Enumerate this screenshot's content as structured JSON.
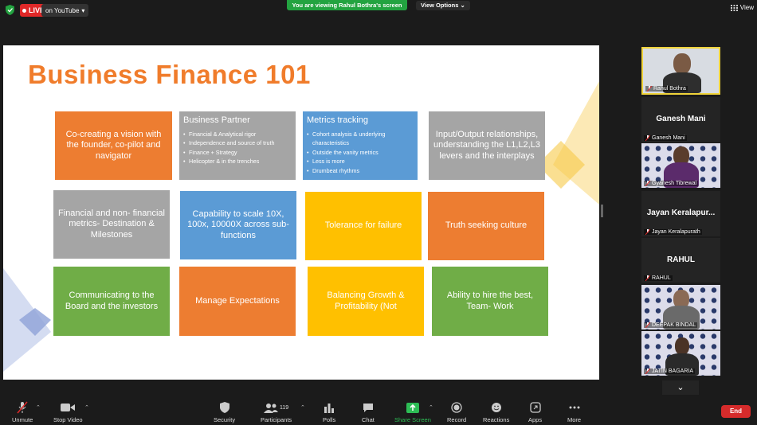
{
  "top_bar": {
    "live_label": "LIVE",
    "youtube_label": "on YouTube",
    "viewing_banner": "You are viewing Rahul Bothra's screen",
    "view_options_label": "View Options",
    "view_label": "View"
  },
  "slide": {
    "title": "Business Finance 101",
    "row1": [
      {
        "text": "Co-creating a vision with the founder, co-pilot and navigator"
      },
      {
        "heading": "Business Partner",
        "bullets": [
          "Financial & Analytical rigor",
          "Independence and source of truth",
          "Finance + Strategy",
          "Helicopter & in the trenches"
        ]
      },
      {
        "heading": "Metrics tracking",
        "bullets": [
          "Cohort analysis & underlying characteristics",
          "Outside the vanity metrics",
          "Less is more",
          "Drumbeat rhythms"
        ]
      },
      {
        "text": "Input/Output relationships, understanding the L1,L2,L3 levers and the interplays"
      }
    ],
    "row2": [
      {
        "text": "Financial and non- financial metrics- Destination & Milestones"
      },
      {
        "text": "Capability to scale 10X, 100x, 10000X across sub-functions"
      },
      {
        "text": "Tolerance for failure"
      },
      {
        "text": "Truth seeking culture"
      }
    ],
    "row3": [
      {
        "text": "Communicating to the Board and the investors"
      },
      {
        "text": "Manage Expectations"
      },
      {
        "text": "Balancing Growth & Profitability (Not"
      },
      {
        "text": "Ability to hire the best, Team- Work"
      }
    ]
  },
  "participants": {
    "speaker": "Rahul Bothra",
    "ganesh_big": "Ganesh Mani",
    "ganesh_small": "Ganesh Mani",
    "gyanesh": "Gyanesh Tibrewal",
    "jayan_big": "Jayan Keralapur...",
    "jayan_small": "Jayan Keralapurath",
    "rahul_big": "RAHUL",
    "rahul_small": "RAHUL",
    "deepak": "DEEPAK BINDAL",
    "jatin": "JATIN BAGARIA"
  },
  "toolbar": {
    "unmute": "Unmute",
    "stop_video": "Stop Video",
    "security": "Security",
    "participants": "Participants",
    "participants_count": "119",
    "polls": "Polls",
    "chat": "Chat",
    "share_screen": "Share Screen",
    "record": "Record",
    "reactions": "Reactions",
    "apps": "Apps",
    "more": "More",
    "end": "End"
  },
  "colors": {
    "accent_green": "#23a340",
    "live_red": "#e02828",
    "speaker_border": "#f0d43a",
    "title_orange": "#f07c2b"
  }
}
